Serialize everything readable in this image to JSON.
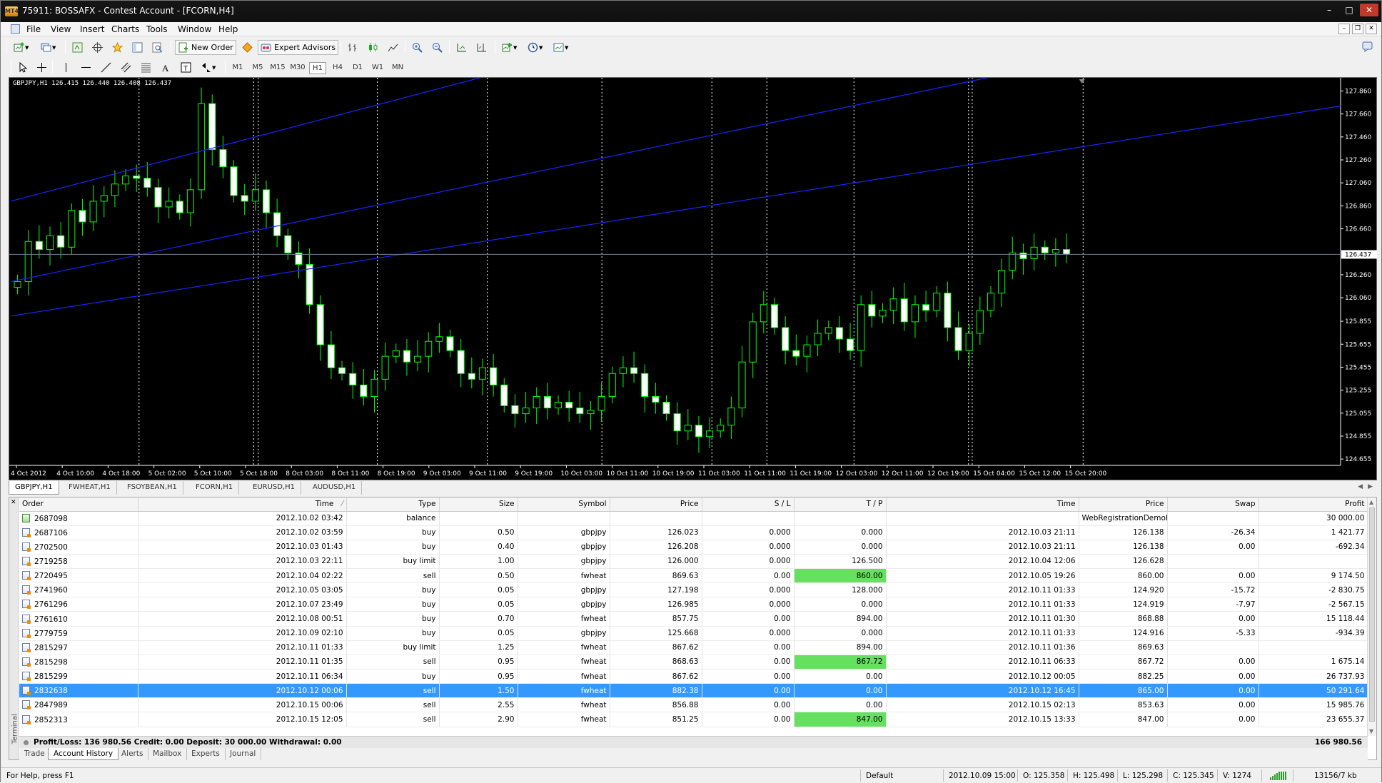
{
  "window": {
    "title": "75911: BOSSAFX - Contest Account - [FCORN,H4]",
    "app_icon_text": "MT4"
  },
  "menu": [
    "File",
    "View",
    "Insert",
    "Charts",
    "Tools",
    "Window",
    "Help"
  ],
  "toolbar": {
    "new_order_label": "New Order",
    "expert_advisors_label": "Expert Advisors",
    "timeframes": [
      "M1",
      "M5",
      "M15",
      "M30",
      "H1",
      "H4",
      "D1",
      "W1",
      "MN"
    ],
    "active_timeframe": "H1"
  },
  "chart": {
    "caption": "GBPJPY,H1  126.415 126.440 126.408 126.437",
    "price_marker": "126.437",
    "chart_data": {
      "type": "candlestick",
      "symbol": "GBPJPY",
      "timeframe": "H1",
      "y_ticks": [
        "127.860",
        "127.660",
        "127.460",
        "127.260",
        "127.060",
        "126.860",
        "126.660",
        "126.260",
        "126.060",
        "125.855",
        "125.655",
        "125.455",
        "125.255",
        "125.055",
        "124.855",
        "124.655"
      ],
      "x_ticks": [
        "4 Oct 2012",
        "4 Oct 10:00",
        "4 Oct 18:00",
        "5 Oct 02:00",
        "5 Oct 10:00",
        "5 Oct 18:00",
        "8 Oct 03:00",
        "8 Oct 11:00",
        "8 Oct 19:00",
        "9 Oct 03:00",
        "9 Oct 11:00",
        "9 Oct 19:00",
        "10 Oct 03:00",
        "10 Oct 11:00",
        "10 Oct 19:00",
        "11 Oct 03:00",
        "11 Oct 11:00",
        "11 Oct 19:00",
        "12 Oct 03:00",
        "12 Oct 11:00",
        "12 Oct 19:00",
        "15 Oct 04:00",
        "15 Oct 12:00",
        "15 Oct 20:00"
      ],
      "ylim": [
        124.6,
        127.95
      ],
      "current_price": 126.437,
      "candle_color": "#00ff00",
      "background": "#000000",
      "close_series": [
        126.2,
        126.55,
        126.48,
        126.6,
        126.5,
        126.82,
        126.72,
        126.9,
        126.95,
        127.05,
        127.12,
        127.1,
        127.02,
        126.85,
        126.9,
        126.8,
        127.0,
        127.75,
        127.35,
        127.2,
        126.95,
        126.9,
        127.0,
        126.8,
        126.6,
        126.45,
        126.35,
        126.0,
        125.65,
        125.45,
        125.4,
        125.3,
        125.2,
        125.35,
        125.55,
        125.6,
        125.5,
        125.55,
        125.68,
        125.72,
        125.6,
        125.4,
        125.35,
        125.45,
        125.3,
        125.12,
        125.05,
        125.1,
        125.2,
        125.1,
        125.15,
        125.1,
        125.05,
        125.08,
        125.2,
        125.4,
        125.45,
        125.4,
        125.2,
        125.15,
        125.05,
        124.9,
        124.95,
        124.85,
        124.9,
        124.95,
        125.1,
        125.5,
        125.85,
        126.0,
        125.8,
        125.6,
        125.55,
        125.65,
        125.75,
        125.8,
        125.7,
        125.6,
        126.0,
        125.9,
        125.95,
        126.05,
        125.85,
        126.0,
        125.95,
        126.1,
        125.8,
        125.6,
        125.75,
        125.95,
        126.1,
        126.3,
        126.45,
        126.4,
        126.5,
        126.45,
        126.48,
        126.44
      ],
      "trend_lines": [
        {
          "from": [
            "4 Oct 2012",
            126.9
          ],
          "to": [
            "9 Oct 11:00",
            127.95
          ]
        },
        {
          "from": [
            "4 Oct 2012",
            126.2
          ],
          "to": [
            "15 Oct 04:00",
            127.95
          ]
        },
        {
          "from": [
            "4 Oct 2012",
            125.9
          ],
          "to": [
            "15 Oct 20:00",
            127.35
          ]
        }
      ]
    }
  },
  "chart_tabs": [
    "GBPJPY,H1",
    "FWHEAT,H1",
    "FSOYBEAN,H1",
    "FCORN,H1",
    "EURUSD,H1",
    "AUDUSD,H1"
  ],
  "terminal": {
    "side_label": "Terminal",
    "columns": [
      "Order",
      "Time",
      "Type",
      "Size",
      "Symbol",
      "Price",
      "S / L",
      "T / P",
      "Time",
      "Price",
      "Swap",
      "Profit"
    ],
    "rows": [
      {
        "order": "2687098",
        "time": "2012.10.02 03:42",
        "type": "balance",
        "size": "",
        "symbol": "",
        "price": "",
        "sl": "",
        "tp": "",
        "ctime": "",
        "cprice": "WebRegistrationDemoPlugin:Initi",
        "swap": "",
        "profit": "30 000.00",
        "kind": "balance"
      },
      {
        "order": "2687106",
        "time": "2012.10.02 03:59",
        "type": "buy",
        "size": "0.50",
        "symbol": "gbpjpy",
        "price": "126.023",
        "sl": "0.000",
        "tp": "0.000",
        "ctime": "2012.10.03 21:11",
        "cprice": "126.138",
        "swap": "-26.34",
        "profit": "1 421.77",
        "kind": "deal"
      },
      {
        "order": "2702500",
        "time": "2012.10.03 01:43",
        "type": "buy",
        "size": "0.40",
        "symbol": "gbpjpy",
        "price": "126.208",
        "sl": "0.000",
        "tp": "0.000",
        "ctime": "2012.10.03 21:11",
        "cprice": "126.138",
        "swap": "0.00",
        "profit": "-692.34",
        "kind": "deal"
      },
      {
        "order": "2719258",
        "time": "2012.10.03 22:11",
        "type": "buy limit",
        "size": "1.00",
        "symbol": "gbpjpy",
        "price": "126.000",
        "sl": "0.000",
        "tp": "126.500",
        "ctime": "2012.10.04 12:06",
        "cprice": "126.628",
        "swap": "",
        "profit": "",
        "kind": "order"
      },
      {
        "order": "2720495",
        "time": "2012.10.04 02:22",
        "type": "sell",
        "size": "0.50",
        "symbol": "fwheat",
        "price": "869.63",
        "sl": "0.00",
        "tp": "860.00",
        "ctime": "2012.10.05 19:26",
        "cprice": "860.00",
        "swap": "0.00",
        "profit": "9 174.50",
        "kind": "deal",
        "tp_hit": true
      },
      {
        "order": "2741960",
        "time": "2012.10.05 03:05",
        "type": "buy",
        "size": "0.05",
        "symbol": "gbpjpy",
        "price": "127.198",
        "sl": "0.000",
        "tp": "128.000",
        "ctime": "2012.10.11 01:33",
        "cprice": "124.920",
        "swap": "-15.72",
        "profit": "-2 830.75",
        "kind": "deal"
      },
      {
        "order": "2761296",
        "time": "2012.10.07 23:49",
        "type": "buy",
        "size": "0.05",
        "symbol": "gbpjpy",
        "price": "126.985",
        "sl": "0.000",
        "tp": "0.000",
        "ctime": "2012.10.11 01:33",
        "cprice": "124.919",
        "swap": "-7.97",
        "profit": "-2 567.15",
        "kind": "deal"
      },
      {
        "order": "2761610",
        "time": "2012.10.08 00:51",
        "type": "buy",
        "size": "0.70",
        "symbol": "fwheat",
        "price": "857.75",
        "sl": "0.00",
        "tp": "894.00",
        "ctime": "2012.10.11 01:30",
        "cprice": "868.88",
        "swap": "0.00",
        "profit": "15 118.44",
        "kind": "deal"
      },
      {
        "order": "2779759",
        "time": "2012.10.09 02:10",
        "type": "buy",
        "size": "0.05",
        "symbol": "gbpjpy",
        "price": "125.668",
        "sl": "0.000",
        "tp": "0.000",
        "ctime": "2012.10.11 01:33",
        "cprice": "124.916",
        "swap": "-5.33",
        "profit": "-934.39",
        "kind": "deal"
      },
      {
        "order": "2815297",
        "time": "2012.10.11 01:33",
        "type": "buy limit",
        "size": "1.25",
        "symbol": "fwheat",
        "price": "867.62",
        "sl": "0.00",
        "tp": "894.00",
        "ctime": "2012.10.11 01:36",
        "cprice": "869.63",
        "swap": "",
        "profit": "",
        "kind": "order"
      },
      {
        "order": "2815298",
        "time": "2012.10.11 01:35",
        "type": "sell",
        "size": "0.95",
        "symbol": "fwheat",
        "price": "868.63",
        "sl": "0.00",
        "tp": "867.72",
        "ctime": "2012.10.11 06:33",
        "cprice": "867.72",
        "swap": "0.00",
        "profit": "1 675.14",
        "kind": "deal",
        "tp_hit": true
      },
      {
        "order": "2815299",
        "time": "2012.10.11 06:34",
        "type": "buy",
        "size": "0.95",
        "symbol": "fwheat",
        "price": "867.62",
        "sl": "0.00",
        "tp": "0.00",
        "ctime": "2012.10.12 00:05",
        "cprice": "882.25",
        "swap": "0.00",
        "profit": "26 737.93",
        "kind": "deal"
      },
      {
        "order": "2832638",
        "time": "2012.10.12 00:06",
        "type": "sell",
        "size": "1.50",
        "symbol": "fwheat",
        "price": "882.38",
        "sl": "0.00",
        "tp": "0.00",
        "ctime": "2012.10.12 16:45",
        "cprice": "865.00",
        "swap": "0.00",
        "profit": "50 291.64",
        "kind": "deal",
        "selected": true
      },
      {
        "order": "2847989",
        "time": "2012.10.15 00:06",
        "type": "sell",
        "size": "2.55",
        "symbol": "fwheat",
        "price": "856.88",
        "sl": "0.00",
        "tp": "0.00",
        "ctime": "2012.10.15 02:13",
        "cprice": "853.63",
        "swap": "0.00",
        "profit": "15 985.76",
        "kind": "deal"
      },
      {
        "order": "2852313",
        "time": "2012.10.15 12:05",
        "type": "sell",
        "size": "2.90",
        "symbol": "fwheat",
        "price": "851.25",
        "sl": "0.00",
        "tp": "847.00",
        "ctime": "2012.10.15 13:33",
        "cprice": "847.00",
        "swap": "0.00",
        "profit": "23 655.37",
        "kind": "deal",
        "tp_hit": true
      }
    ],
    "summary": "Profit/Loss: 136 980.56  Credit: 0.00  Deposit: 30 000.00  Withdrawal: 0.00",
    "summary_total": "166 980.56",
    "tabs": [
      "Trade",
      "Account History",
      "Alerts",
      "Mailbox",
      "Experts",
      "Journal"
    ],
    "active_tab": "Account History"
  },
  "statusbar": {
    "help": "For Help, press F1",
    "profile": "Default",
    "time": "2012.10.09 15:00",
    "open": "O: 125.358",
    "high": "H: 125.498",
    "low": "L: 125.298",
    "close": "C: 125.345",
    "volume": "V: 1274",
    "traffic": "13156/7 kb"
  }
}
